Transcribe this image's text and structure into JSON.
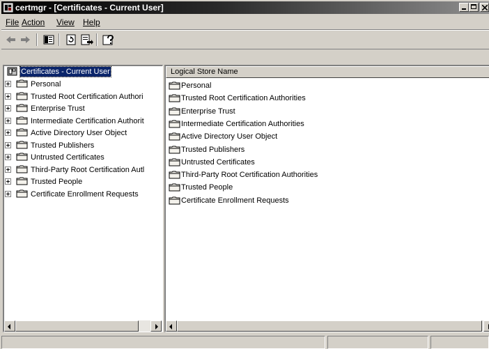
{
  "window": {
    "title": "certmgr - [Certificates - Current User]"
  },
  "menu": [
    {
      "key": "file",
      "label": "File"
    },
    {
      "key": "action",
      "label": "Action"
    },
    {
      "key": "view",
      "label": "View"
    },
    {
      "key": "help",
      "label": "Help"
    }
  ],
  "toolbar": {
    "buttons": [
      "back-arrow-icon",
      "forward-arrow-icon",
      "show-hide-console-tree-icon",
      "refresh-icon",
      "export-list-icon",
      "help-icon"
    ]
  },
  "tree": {
    "root": "Certificates - Current User",
    "items": [
      "Personal",
      "Trusted Root Certification Authori",
      "Enterprise Trust",
      "Intermediate Certification Authorit",
      "Active Directory User Object",
      "Trusted Publishers",
      "Untrusted Certificates",
      "Third-Party Root Certification Autl",
      "Trusted People",
      "Certificate Enrollment Requests"
    ]
  },
  "list": {
    "column_header": "Logical Store Name",
    "items": [
      "Personal",
      "Trusted Root Certification Authorities",
      "Enterprise Trust",
      "Intermediate Certification Authorities",
      "Active Directory User Object",
      "Trusted Publishers",
      "Untrusted Certificates",
      "Third-Party Root Certification Authorities",
      "Trusted People",
      "Certificate Enrollment Requests"
    ]
  },
  "colors": {
    "chrome": "#d4d0c8",
    "selection": "#0a246a",
    "folder": "#f4f2ec"
  }
}
